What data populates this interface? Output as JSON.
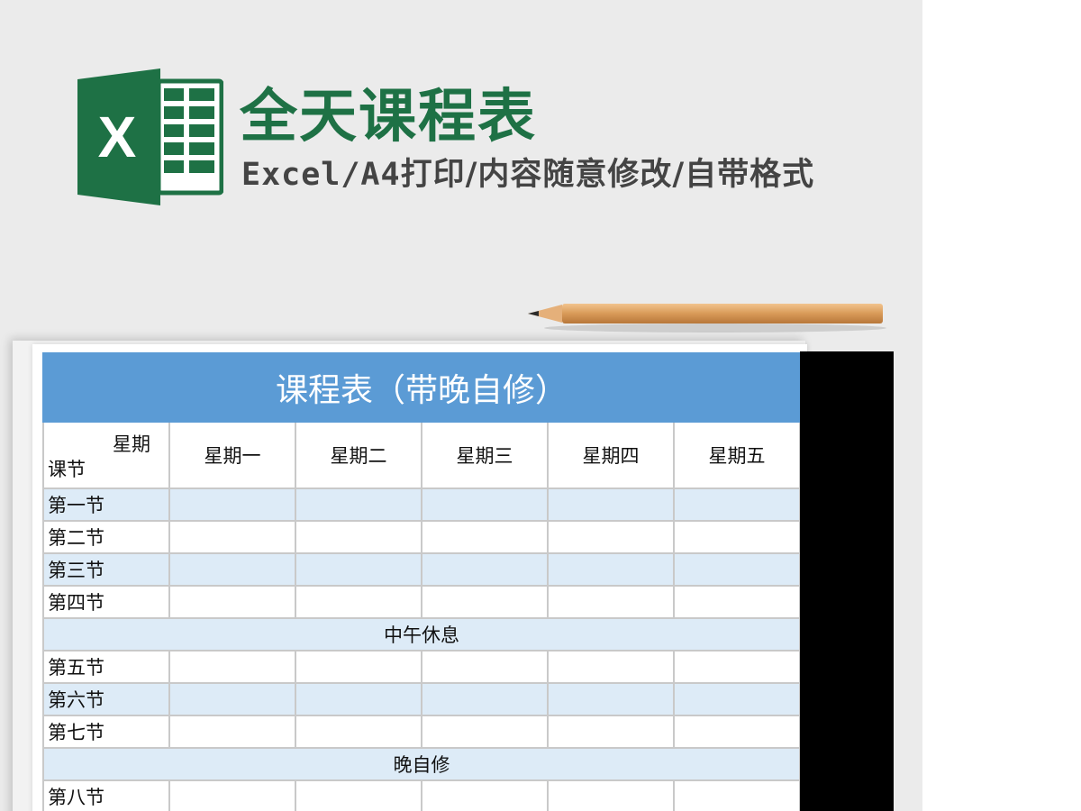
{
  "banner": {
    "title": "全天课程表",
    "subtitle_mono": "Excel/A4",
    "subtitle_rest": "打印/内容随意修改/自带格式",
    "logo_letter": "X",
    "logo_icon": "excel-logo-icon",
    "pencil_icon": "pencil-icon"
  },
  "colors": {
    "brand_green": "#1e7145",
    "header_blue": "#5b9bd5",
    "stripe_blue": "#ddebf7"
  },
  "sheet": {
    "title": "课程表（带晚自修）",
    "corner_top": "星期",
    "corner_bottom": "课节",
    "days": [
      "星期一",
      "星期二",
      "星期三",
      "星期四",
      "星期五"
    ],
    "periods": [
      "第一节",
      "第二节",
      "第三节",
      "第四节",
      "第五节",
      "第六节",
      "第七节",
      "第八节"
    ],
    "noon_break": "中午休息",
    "evening_study": "晚自修"
  }
}
